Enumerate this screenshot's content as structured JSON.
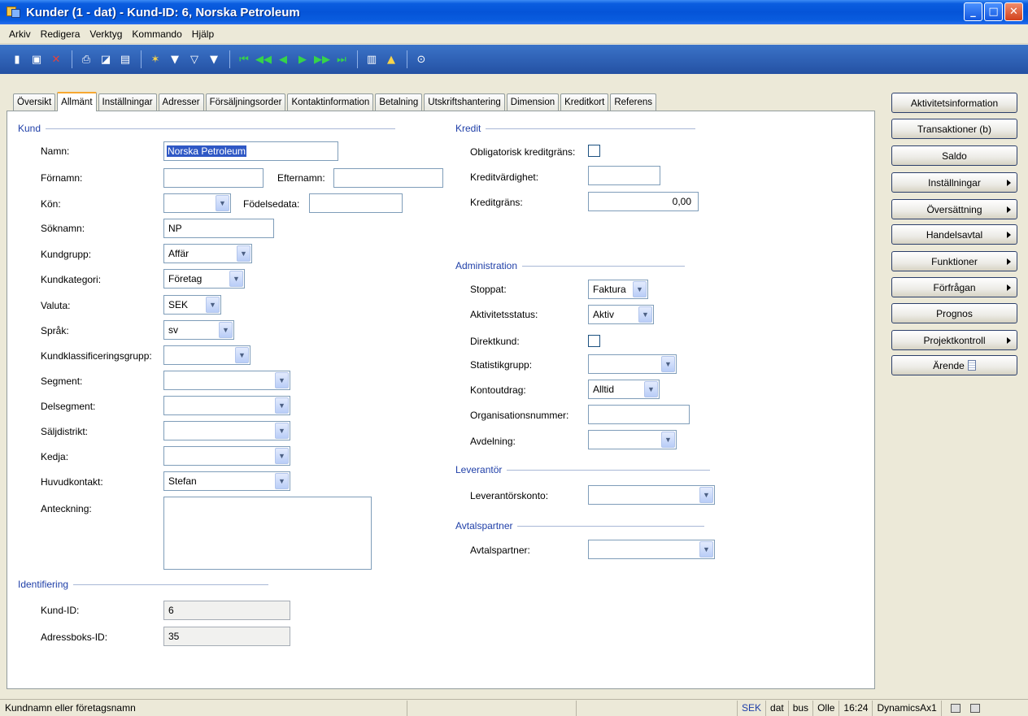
{
  "window": {
    "title": "Kunder (1 - dat) - Kund-ID: 6, Norska Petroleum"
  },
  "menu": [
    "Arkiv",
    "Redigera",
    "Verktyg",
    "Kommando",
    "Hjälp"
  ],
  "tabs": [
    "Översikt",
    "Allmänt",
    "Inställningar",
    "Adresser",
    "Försäljningsorder",
    "Kontaktinformation",
    "Betalning",
    "Utskriftshantering",
    "Dimension",
    "Kreditkort",
    "Referens"
  ],
  "kund": {
    "title": "Kund",
    "namn_label": "Namn:",
    "namn_value": "Norska Petroleum",
    "fornamn_label": "Förnamn:",
    "fornamn_value": "",
    "efternamn_label": "Efternamn:",
    "efternamn_value": "",
    "kon_label": "Kön:",
    "kon_value": "",
    "fodelsedata_label": "Födelsedata:",
    "fodelsedata_value": "",
    "soknamn_label": "Söknamn:",
    "soknamn_value": "NP",
    "kundgrupp_label": "Kundgrupp:",
    "kundgrupp_value": "Affär",
    "kundkategori_label": "Kundkategori:",
    "kundkategori_value": "Företag",
    "valuta_label": "Valuta:",
    "valuta_value": "SEK",
    "sprak_label": "Språk:",
    "sprak_value": "sv",
    "kundklass_label": "Kundklassificeringsgrupp:",
    "kundklass_value": "",
    "segment_label": "Segment:",
    "segment_value": "",
    "delsegment_label": "Delsegment:",
    "delsegment_value": "",
    "saljdistrikt_label": "Säljdistrikt:",
    "saljdistrikt_value": "",
    "kedja_label": "Kedja:",
    "kedja_value": "",
    "huvudkontakt_label": "Huvudkontakt:",
    "huvudkontakt_value": "Stefan",
    "anteckning_label": "Anteckning:"
  },
  "identifiering": {
    "title": "Identifiering",
    "kundid_label": "Kund-ID:",
    "kundid_value": "6",
    "adressbok_label": "Adressboks-ID:",
    "adressbok_value": "35"
  },
  "kredit": {
    "title": "Kredit",
    "oblig_label": "Obligatorisk kreditgräns:",
    "kreditvard_label": "Kreditvärdighet:",
    "kreditvard_value": "",
    "kreditgrans_label": "Kreditgräns:",
    "kreditgrans_value": "0,00"
  },
  "administration": {
    "title": "Administration",
    "stoppat_label": "Stoppat:",
    "stoppat_value": "Faktura",
    "aktstatus_label": "Aktivitetsstatus:",
    "aktstatus_value": "Aktiv",
    "direktkund_label": "Direktkund:",
    "statgrupp_label": "Statistikgrupp:",
    "statgrupp_value": "",
    "kontoutdrag_label": "Kontoutdrag:",
    "kontoutdrag_value": "Alltid",
    "orgnr_label": "Organisationsnummer:",
    "orgnr_value": "",
    "avdelning_label": "Avdelning:",
    "avdelning_value": ""
  },
  "leverantor": {
    "title": "Leverantör",
    "konto_label": "Leverantörskonto:",
    "konto_value": ""
  },
  "avtalspartner": {
    "title": "Avtalspartner",
    "label": "Avtalspartner:",
    "value": ""
  },
  "side_buttons": [
    "Aktivitetsinformation",
    "Transaktioner (b)",
    "Saldo",
    "Inställningar",
    "Översättning",
    "Handelsavtal",
    "Funktioner",
    "Förfrågan",
    "Prognos",
    "Projektkontroll",
    "Ärende"
  ],
  "status": {
    "help": "Kundnamn eller företagsnamn",
    "currency": "SEK",
    "company": "dat",
    "layer": "bus",
    "user": "Olle",
    "time": "16:24",
    "app": "DynamicsAx1"
  }
}
